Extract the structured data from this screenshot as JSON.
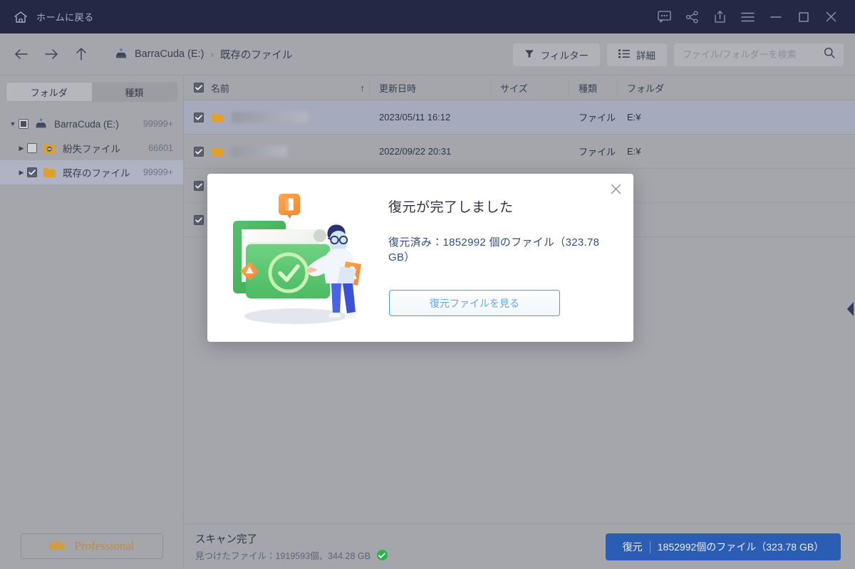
{
  "titlebar": {
    "home_label": "ホームに戻る",
    "home_icon": "home-icon",
    "actions": [
      {
        "name": "feedback-icon",
        "label": "フィードバック"
      },
      {
        "name": "share-icon",
        "label": "共有"
      },
      {
        "name": "upload-icon",
        "label": "アップロード"
      },
      {
        "name": "menu-icon",
        "label": "メニュー"
      },
      {
        "name": "minimize-icon",
        "label": "最小化"
      },
      {
        "name": "maximize-icon",
        "label": "最大化"
      },
      {
        "name": "close-icon",
        "label": "閉じる"
      }
    ],
    "bg_color": "#232845"
  },
  "navbar": {
    "back_icon": "arrow-left-icon",
    "forward_icon": "arrow-right-icon",
    "up_icon": "arrow-up-icon",
    "breadcrumb": {
      "drive_icon": "hard-drive-icon",
      "drive": "BarraCuda (E:)",
      "separator": "›",
      "current": "既存のファイル"
    },
    "filter_button": "フィルター",
    "filter_icon": "funnel-icon",
    "detail_button": "詳細",
    "detail_icon": "list-icon",
    "search": {
      "placeholder": "ファイル/フォルダーを検索",
      "value": "",
      "icon": "search-icon"
    }
  },
  "sidebar": {
    "tabs": [
      {
        "label": "フォルダ",
        "active": true
      },
      {
        "label": "種類",
        "active": false
      }
    ],
    "tree": [
      {
        "label": "BarraCuda (E:)",
        "count": "99999+",
        "level": 0,
        "icon": "hard-drive-icon",
        "check": "partial",
        "expanded": true,
        "selected": false
      },
      {
        "label": "紛失ファイル",
        "count": "66601",
        "level": 1,
        "icon": "lost-folder-icon",
        "check": "unchecked",
        "expanded": false,
        "selected": false
      },
      {
        "label": "既存のファイル",
        "count": "99999+",
        "level": 1,
        "icon": "folder-icon",
        "check": "checked",
        "expanded": false,
        "selected": true
      }
    ],
    "pro_button": {
      "label": "Professional",
      "icon": "crown-icon",
      "color": "#c08a3c"
    }
  },
  "table": {
    "columns": [
      {
        "key": "name",
        "label": "名前",
        "sorted": true,
        "sort_icon": "arrow-up-icon"
      },
      {
        "key": "date",
        "label": "更新日時"
      },
      {
        "key": "size",
        "label": "サイズ"
      },
      {
        "key": "kind",
        "label": "種類"
      },
      {
        "key": "folder",
        "label": "フォルダ"
      }
    ],
    "select_all": true,
    "rows": [
      {
        "checked": true,
        "name": "",
        "redacted": true,
        "redacted_width": 108,
        "date": "2023/05/11 16:12",
        "size": "",
        "kind": "ファイル フ…",
        "folder": "E:¥",
        "selected": true
      },
      {
        "checked": true,
        "name": "",
        "redacted": true,
        "redacted_width": 78,
        "date": "2022/09/22 20:31",
        "size": "",
        "kind": "ファイル フ…",
        "folder": "E:¥",
        "selected": false
      },
      {
        "checked": true,
        "name": "",
        "redacted": true,
        "redacted_width": 92,
        "date": "",
        "size": "",
        "kind": "",
        "folder": "",
        "selected": false
      },
      {
        "checked": true,
        "name": "",
        "redacted": true,
        "redacted_width": 84,
        "date": "",
        "size": "",
        "kind": "",
        "folder": "",
        "selected": false
      }
    ]
  },
  "side_handle": {
    "icon": "chevron-left-icon"
  },
  "statusbar": {
    "title": "スキャン完了",
    "subtitle": "見つけたファイル：1919593個、344.28 GB",
    "status_icon": "check-circle-icon",
    "recover_button": {
      "label": "復元",
      "detail": "1852992個のファイル（323.78 GB）",
      "color": "#2c5db5"
    }
  },
  "modal": {
    "close_icon": "close-icon",
    "illustration": "folder-recovery-illustration",
    "title": "復元が完了しました",
    "subtitle": "復元済み：1852992 個のファイル（323.78 GB）",
    "button_label": "復元ファイルを見る",
    "button_color": "#64a7e8"
  }
}
